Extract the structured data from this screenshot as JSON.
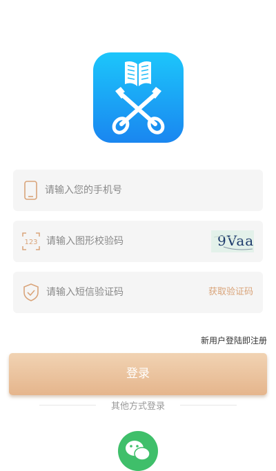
{
  "form": {
    "phone_placeholder": "请输入您的手机号",
    "captcha_placeholder": "请输入图形校验码",
    "captcha_image_text": "9Vaa",
    "sms_placeholder": "请输入短信验证码",
    "get_code_label": "获取验证码"
  },
  "register_link": "新用户登陆即注册",
  "login_button": "登录",
  "other_login_label": "其他方式登录",
  "colors": {
    "accent": "#e5b58c",
    "logo_gradient_top": "#1cc6fb",
    "logo_gradient_bottom": "#1a86f0",
    "field_background": "#f5f5f5",
    "wechat_green": "#3fbf6a"
  },
  "icons": [
    "app-logo-book-keys",
    "phone-icon",
    "number-123-icon",
    "shield-check-icon",
    "wechat-icon"
  ]
}
